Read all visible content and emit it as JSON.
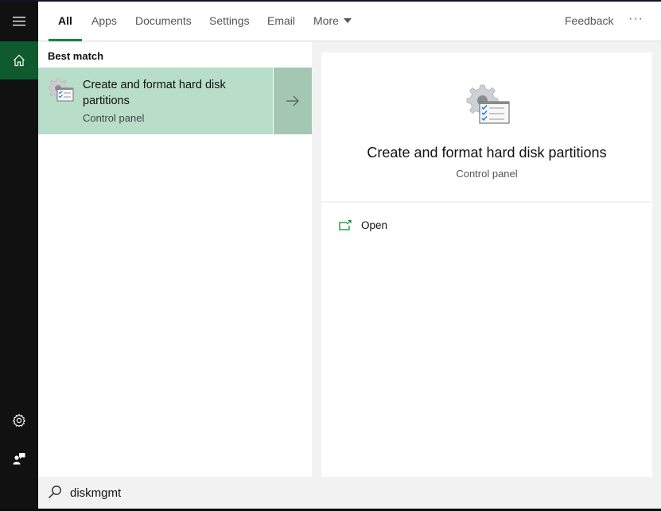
{
  "tabs": [
    {
      "label": "All",
      "active": true
    },
    {
      "label": "Apps"
    },
    {
      "label": "Documents"
    },
    {
      "label": "Settings"
    },
    {
      "label": "Email"
    },
    {
      "label": "More"
    }
  ],
  "header": {
    "feedback_label": "Feedback",
    "more_options": "···"
  },
  "sidebar": {
    "items": [
      {
        "icon": "hamburger-menu-icon"
      },
      {
        "icon": "home-icon",
        "active": true
      },
      {
        "icon": "gear-icon"
      },
      {
        "icon": "feedback-person-icon"
      }
    ]
  },
  "results": {
    "section_label": "Best match",
    "best_match": {
      "title": "Create and format hard disk partitions",
      "subtitle": "Control panel",
      "icon": "control-panel-gear-checklist-icon"
    }
  },
  "preview": {
    "title": "Create and format hard disk partitions",
    "subtitle": "Control panel",
    "actions": [
      {
        "label": "Open",
        "icon": "open-external-icon"
      }
    ]
  },
  "search": {
    "value": "diskmgmt",
    "icon": "search-icon"
  },
  "colors": {
    "accent": "#0f8a3c",
    "sidebar_active": "#0f5a2e",
    "selected_item": "#b8ddc8",
    "selected_arrow": "#a4c7b2"
  }
}
